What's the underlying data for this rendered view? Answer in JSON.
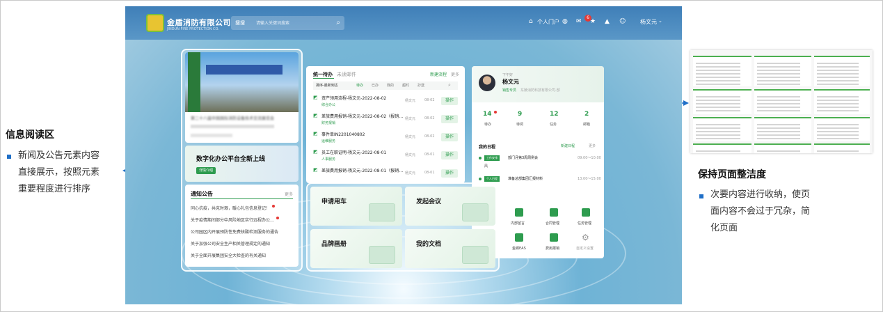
{
  "annotations": {
    "left": {
      "title": "信息阅读区",
      "lines": [
        "新闻及公告元素内容",
        "直接展示，按照元素",
        "重要程度进行排序"
      ]
    },
    "right": {
      "title": "保持页面整洁度",
      "lines": [
        "次要内容进行收纳，使页",
        "面内容不会过于冗杂，简",
        "化页面"
      ]
    }
  },
  "header": {
    "logo_text": "金盾消防有限公司",
    "logo_sub": "JINDUN FIRE PROTECTION CO.",
    "search_category": "搜搜",
    "search_placeholder": "请输入关键词搜索",
    "personal_portal": "个人门户",
    "mail_badge": "6",
    "user_name": "杨文元"
  },
  "news": {
    "headline": "第二十八届中国国际消防设备技术交流展览会",
    "promo_title": "数字化办公平台全新上线",
    "promo_button": "详情介绍",
    "notice_title": "通知公告",
    "more": "更多",
    "notices": [
      "同心抗疫，共克时艰，暖心礼包信息登记！",
      "关于疫情期间部分中风险地区实行远程办公…",
      "公司园区内开展预防性免费核酸检测服务的通告",
      "关于加强公司安全生产相关管理规定的通知",
      "关于全面开展集团安全大检查的有关通知"
    ]
  },
  "todo": {
    "tab_active": "统一待办",
    "tab_inactive": "未读邮件",
    "new_flow": "新建流程",
    "more": "更多",
    "filters": [
      "排序-最新到达",
      "待办",
      "已办",
      "我的",
      "超时",
      "抄送"
    ],
    "items": [
      {
        "title": "资产领用流程-杨文元-2022-08-02",
        "tag": "综合办公",
        "person": "杨文元",
        "date": "08-02",
        "op": "操作"
      },
      {
        "title": "差旅费用报销-杨文元-2022-08-02（报销…",
        "tag": "财务报销",
        "person": "杨文元",
        "date": "08-02",
        "op": "操作"
      },
      {
        "title": "事件单IN2201040802",
        "tag": "运维服务",
        "person": "杨文元",
        "date": "08-02",
        "op": "操作"
      },
      {
        "title": "员工在职证明-杨文元-2022-08-01",
        "tag": "人事服务",
        "person": "杨文元",
        "date": "08-01",
        "op": "操作"
      },
      {
        "title": "差旅费用报销-杨文元-2022-08-01（报销…",
        "tag": "财务报销",
        "person": "杨文元",
        "date": "08-01",
        "op": "操作"
      }
    ]
  },
  "profile": {
    "greeting": "下午好",
    "name": "杨文元",
    "dept": "销售专员",
    "signature": "东陵消防科技有限公司-部",
    "stats": [
      {
        "value": "14",
        "label": "待办"
      },
      {
        "value": "9",
        "label": "待阅"
      },
      {
        "value": "12",
        "label": "任务"
      },
      {
        "value": "2",
        "label": "邮箱"
      }
    ],
    "schedule_title": "我的日程",
    "new_schedule": "新建日程",
    "more": "更多",
    "events": [
      {
        "tag": "工作安排",
        "title": "部门月第3周周例会",
        "time": "09:00～10:00",
        "extra": "风"
      },
      {
        "tag": "个人日程",
        "title": "准备总部集团汇报材料",
        "time": "13:00～15:00"
      }
    ],
    "apps": [
      "内部留言",
      "合同管理",
      "任务管理",
      "金蝶EAS",
      "费用报销",
      "自定义设置"
    ]
  },
  "tiles": [
    "申请用车",
    "发起会议",
    "品牌画册",
    "我的文档"
  ],
  "colors": {
    "accent": "#2e9c4f",
    "header": "#4a88bf",
    "annotation_arrow": "#1f6fc7"
  }
}
